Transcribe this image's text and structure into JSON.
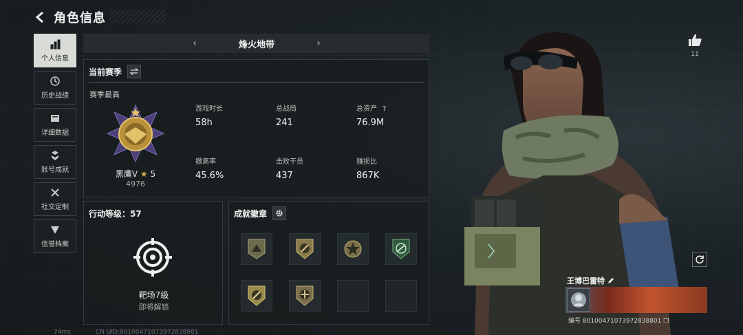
{
  "header": {
    "title": "角色信息"
  },
  "sidebar": {
    "items": [
      {
        "label": "个人信息",
        "icon": "bar-chart-icon",
        "active": true
      },
      {
        "label": "历史战绩",
        "icon": "history-icon",
        "active": false
      },
      {
        "label": "详细数据",
        "icon": "folder-icon",
        "active": false
      },
      {
        "label": "账号成就",
        "icon": "achievement-icon",
        "active": false
      },
      {
        "label": "社交定制",
        "icon": "tools-icon",
        "active": false
      },
      {
        "label": "信誉档案",
        "icon": "credit-icon",
        "active": false
      }
    ]
  },
  "season_bar": {
    "name": "烽火地带"
  },
  "season_panel": {
    "title": "当前赛季",
    "subtitle": "赛季最高",
    "rank": {
      "name": "黑鹰V",
      "stars": "5",
      "points": "4976"
    },
    "stats": [
      {
        "label": "游戏时长",
        "value": "58h"
      },
      {
        "label": "总战局",
        "value": "241"
      },
      {
        "label": "总资产",
        "value": "76.9M",
        "help": "?"
      },
      {
        "label": "撤离率",
        "value": "45.6%"
      },
      {
        "label": "击败干员",
        "value": "437"
      },
      {
        "label": "赚损比",
        "value": "867K"
      }
    ]
  },
  "action_panel": {
    "title": "行动等级：57",
    "target_name": "靶场7级",
    "target_status": "即将解锁"
  },
  "badge_panel": {
    "title": "成就徽章"
  },
  "like": {
    "count": "11"
  },
  "player": {
    "name": "王博巴雷特",
    "id": "编号 80100471073972838801"
  },
  "footer": {
    "ping": "74ms",
    "uid": "CN UID:80100471073972838801"
  },
  "colors": {
    "accent_gold": "#d6b34a",
    "active_tab": "#d9dcd6",
    "panel_bg": "#181d1f"
  }
}
